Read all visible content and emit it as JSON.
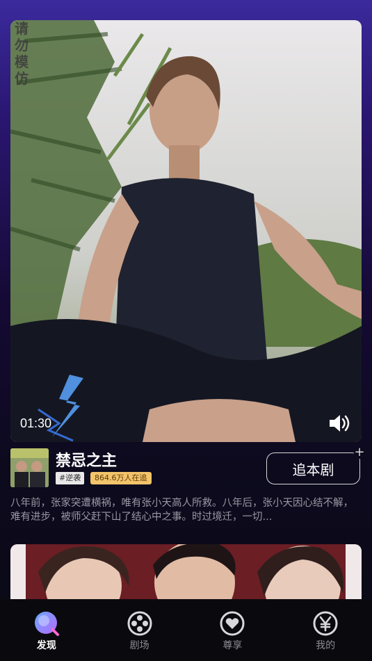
{
  "video": {
    "watermark": "请勿模仿",
    "timestamp": "01:30"
  },
  "drama": {
    "title": "禁忌之主",
    "tag": "#逆袭",
    "viewers": "864.6万人在追",
    "follow_label": "追本剧",
    "description": "八年前，张家突遭横祸，唯有张小天高人所救。八年后，张小天因心结不解，难有进步，被师父赶下山了结心中之事。时过境迁，一切..."
  },
  "nav": {
    "items": [
      {
        "label": "发现",
        "icon": "discover-icon",
        "active": true
      },
      {
        "label": "剧场",
        "icon": "film-reel-icon",
        "active": false
      },
      {
        "label": "尊享",
        "icon": "heart-icon",
        "active": false
      },
      {
        "label": "我的",
        "icon": "yen-icon",
        "active": false
      }
    ]
  },
  "colors": {
    "accent": "#9b6bff",
    "tag_bg": "#e8e8e8",
    "viewers_bg": "#f3c46a",
    "nav_bg": "#0a0a0e"
  }
}
